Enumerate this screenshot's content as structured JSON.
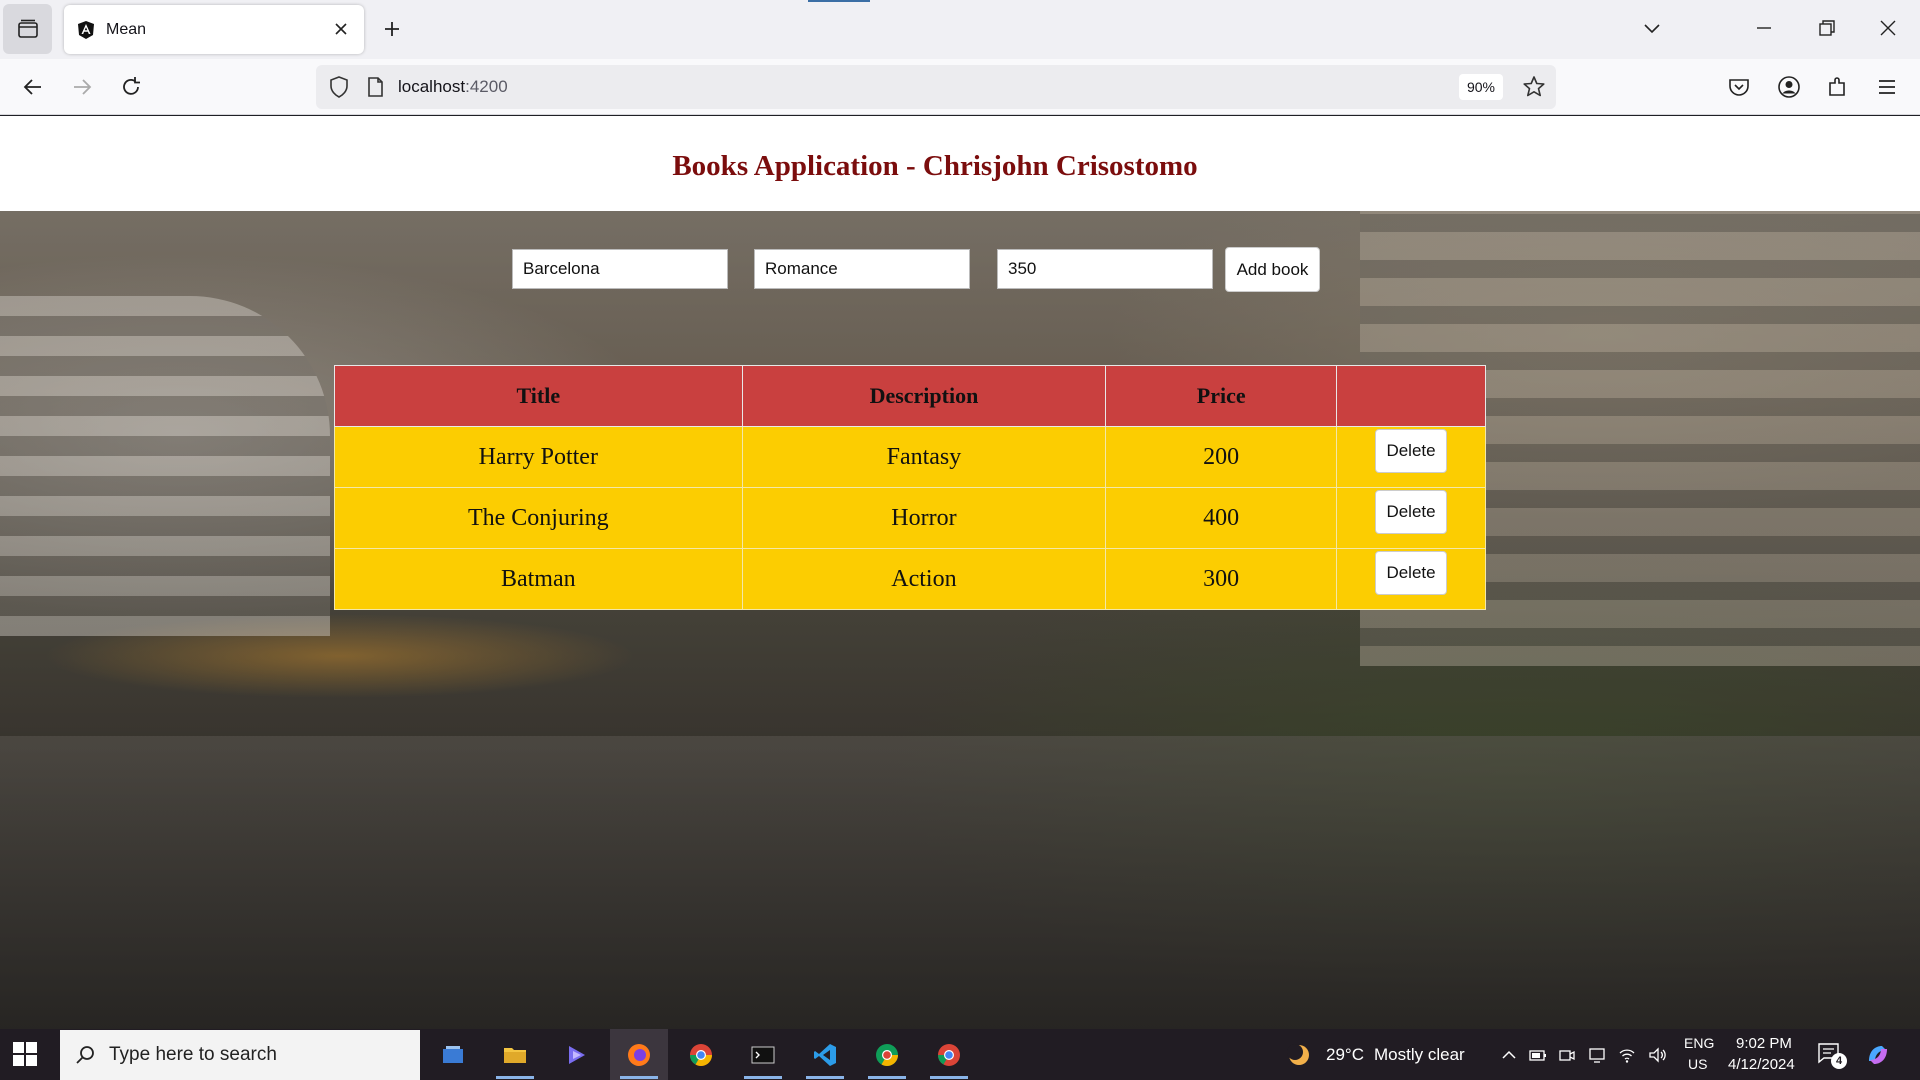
{
  "browser": {
    "tab_title": "Mean",
    "url_host": "localhost",
    "url_port": ":4200",
    "zoom": "90%"
  },
  "page": {
    "title": "Books Application - Chrisjohn Crisostomo",
    "form": {
      "title_value": "Barcelona",
      "description_value": "Romance",
      "price_value": "350",
      "add_button": "Add book"
    },
    "table": {
      "headers": [
        "Title",
        "Description",
        "Price",
        ""
      ],
      "rows": [
        {
          "title": "Harry Potter",
          "description": "Fantasy",
          "price": "200",
          "action": "Delete"
        },
        {
          "title": "The Conjuring",
          "description": "Horror",
          "price": "400",
          "action": "Delete"
        },
        {
          "title": "Batman",
          "description": "Action",
          "price": "300",
          "action": "Delete"
        }
      ]
    }
  },
  "taskbar": {
    "search_placeholder": "Type here to search",
    "weather_temp": "29°C",
    "weather_text": "Mostly clear",
    "lang_top": "ENG",
    "lang_bottom": "US",
    "time": "9:02 PM",
    "date": "4/12/2024",
    "notification_count": "4"
  },
  "colors": {
    "title": "#7b0d0d",
    "table_header": "#c9403f",
    "table_row": "#fccd01"
  }
}
